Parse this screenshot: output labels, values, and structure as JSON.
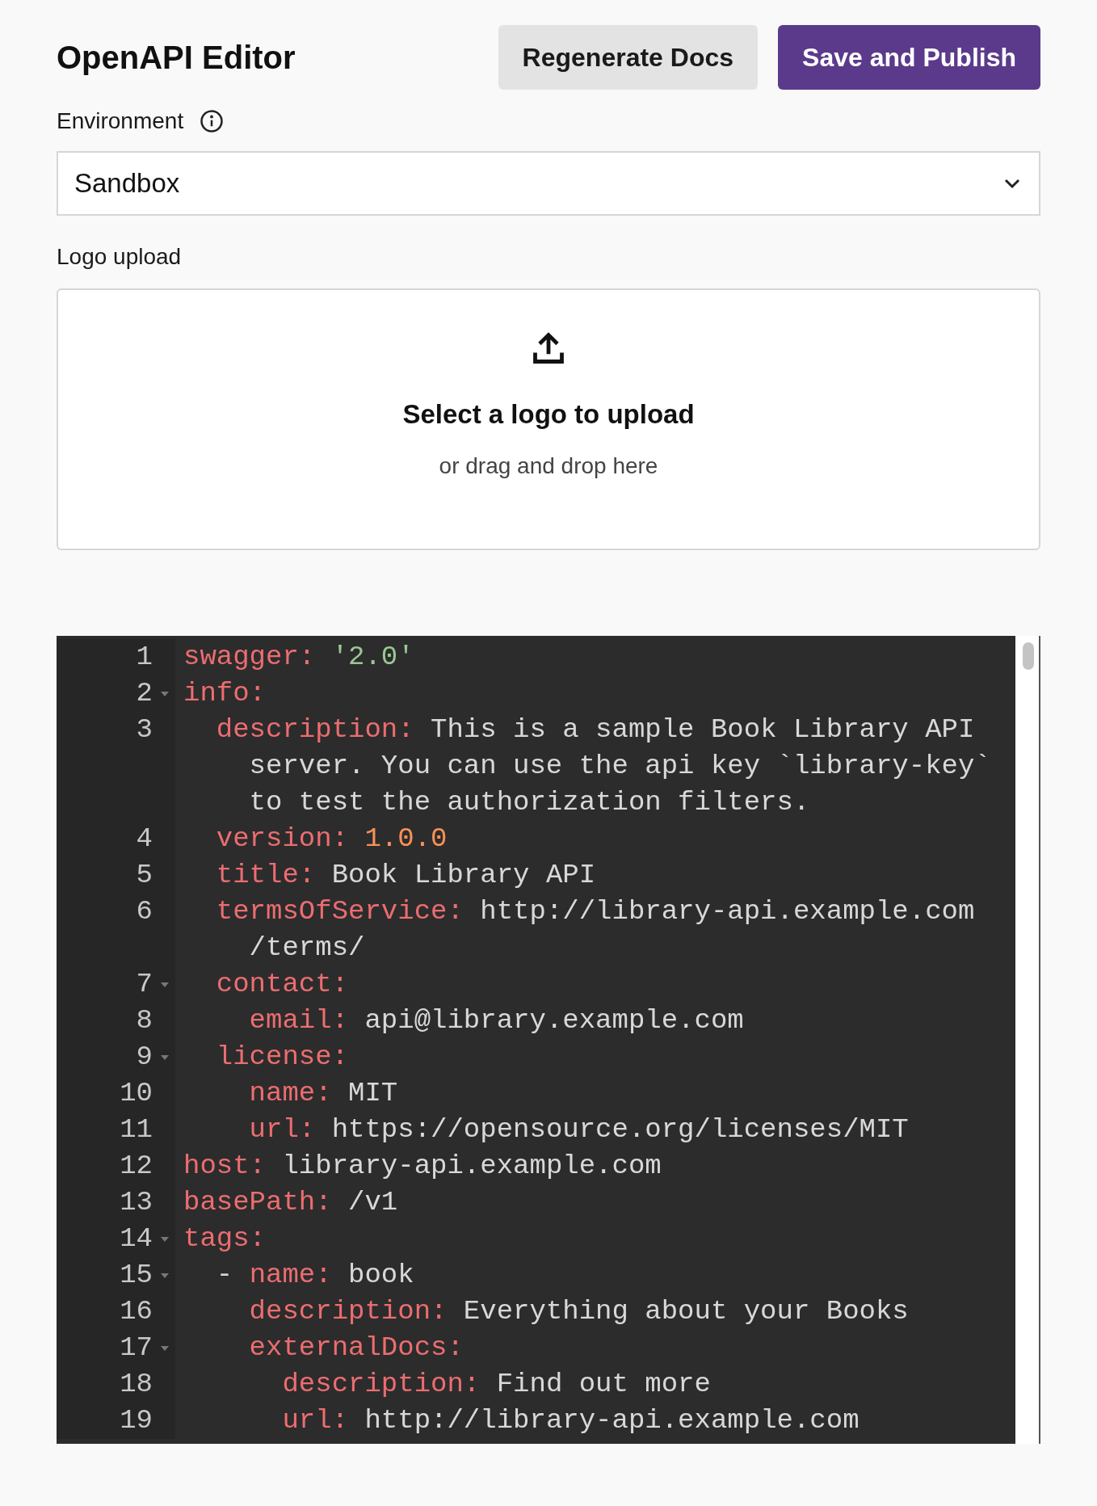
{
  "header": {
    "title": "OpenAPI Editor",
    "buttons": [
      {
        "label": "Regenerate Docs",
        "kind": "secondary"
      },
      {
        "label": "Save and Publish",
        "kind": "primary"
      }
    ]
  },
  "environment": {
    "label": "Environment",
    "value": "Sandbox"
  },
  "logo_upload": {
    "label": "Logo upload",
    "title": "Select a logo to upload",
    "subtitle": "or drag and drop here"
  },
  "editor": {
    "lines": [
      {
        "number": "1",
        "key": "swagger:",
        "value": [
          "'2.0'"
        ],
        "kind": "string",
        "foldable": false
      },
      {
        "number": "2",
        "key": "info:",
        "kind": "plain",
        "foldable": true
      },
      {
        "number": "3",
        "key": "  description:",
        "value": [
          "This is a sample Book Library API",
          "server. You can use the api key `library-key`",
          "to test the authorization filters."
        ],
        "kind": "plain",
        "foldable": false
      },
      {
        "number": "4",
        "key": "  version:",
        "value": [
          "1.0.0"
        ],
        "kind": "number",
        "foldable": false
      },
      {
        "number": "5",
        "key": "  title:",
        "value": [
          "Book Library API"
        ],
        "kind": "plain",
        "foldable": false
      },
      {
        "number": "6",
        "key": "  termsOfService:",
        "value": [
          "http://library-api.example.com",
          "/terms/"
        ],
        "kind": "plain",
        "foldable": false
      },
      {
        "number": "7",
        "key": "  contact:",
        "kind": "plain",
        "foldable": true
      },
      {
        "number": "8",
        "key": "    email:",
        "value": [
          "api@library.example.com"
        ],
        "kind": "plain",
        "foldable": false
      },
      {
        "number": "9",
        "key": "  license:",
        "kind": "plain",
        "foldable": true
      },
      {
        "number": "10",
        "key": "    name:",
        "value": [
          "MIT"
        ],
        "kind": "plain",
        "foldable": false
      },
      {
        "number": "11",
        "key": "    url:",
        "value": [
          "https://opensource.org/licenses/MIT"
        ],
        "kind": "plain",
        "foldable": false
      },
      {
        "number": "12",
        "key": "host:",
        "value": [
          "library-api.example.com"
        ],
        "kind": "plain",
        "foldable": false
      },
      {
        "number": "13",
        "key": "basePath:",
        "value": [
          "/v1"
        ],
        "kind": "plain",
        "foldable": false
      },
      {
        "number": "14",
        "key": "tags:",
        "kind": "plain",
        "foldable": true
      },
      {
        "number": "15",
        "prefix": "  - ",
        "key": "name:",
        "value": [
          "book"
        ],
        "kind": "plain",
        "foldable": true
      },
      {
        "number": "16",
        "key": "    description:",
        "value": [
          "Everything about your Books"
        ],
        "kind": "plain",
        "foldable": false
      },
      {
        "number": "17",
        "key": "    externalDocs:",
        "kind": "plain",
        "foldable": true
      },
      {
        "number": "18",
        "key": "      description:",
        "value": [
          "Find out more"
        ],
        "kind": "plain",
        "foldable": false
      },
      {
        "number": "19",
        "key": "      url:",
        "value": [
          "http://library-api.example.com"
        ],
        "kind": "plain",
        "foldable": false
      }
    ]
  }
}
